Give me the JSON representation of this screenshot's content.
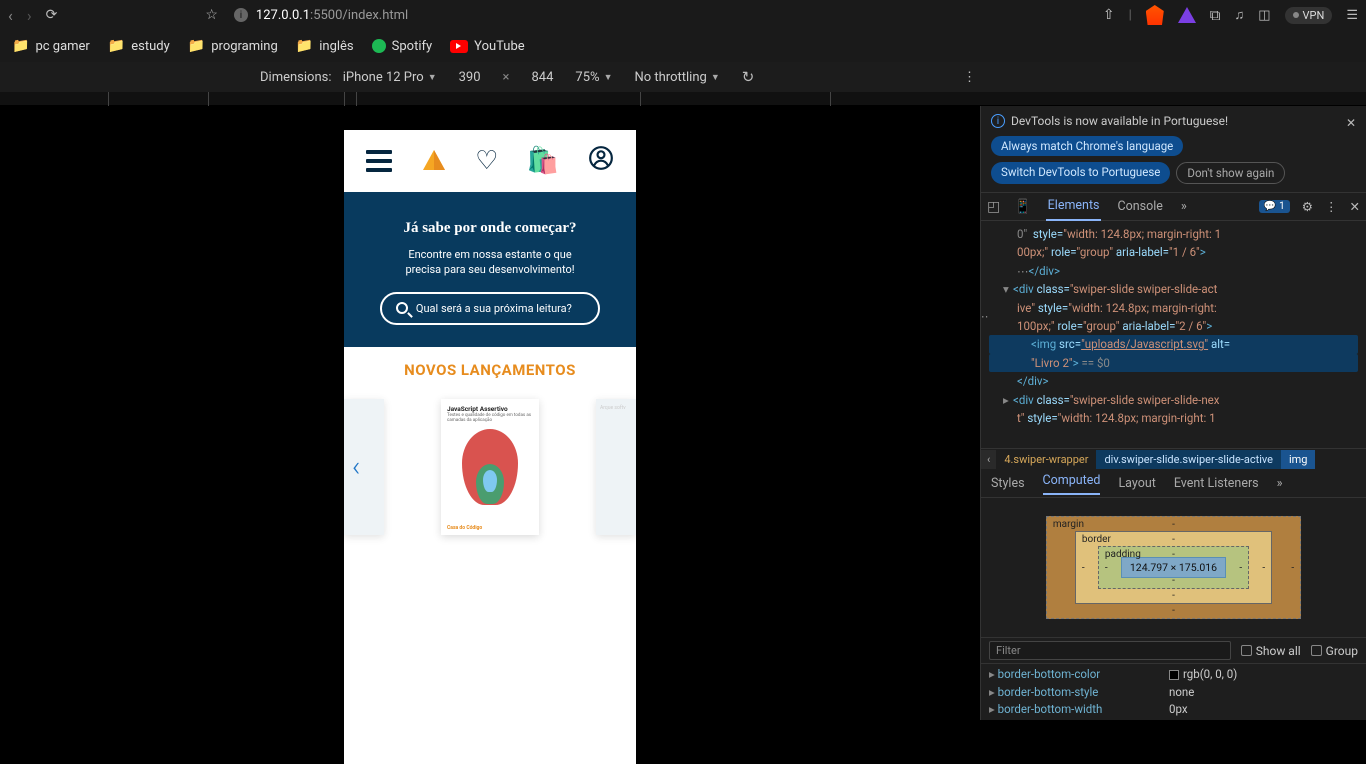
{
  "browser": {
    "url_host": "127.0.0.1",
    "url_path": ":5500/index.html",
    "vpn_label": "VPN"
  },
  "bookmarks": [
    {
      "type": "folder",
      "label": "pc gamer"
    },
    {
      "type": "folder",
      "label": "estudy"
    },
    {
      "type": "folder",
      "label": "programing"
    },
    {
      "type": "folder",
      "label": "inglês"
    },
    {
      "type": "spotify",
      "label": "Spotify"
    },
    {
      "type": "youtube",
      "label": "YouTube"
    }
  ],
  "device_bar": {
    "dimensions_label": "Dimensions:",
    "device": "iPhone 12 Pro",
    "width": "390",
    "sep": "×",
    "height": "844",
    "zoom": "75%",
    "throttle": "No throttling"
  },
  "app": {
    "hero_title": "Já sabe por onde começar?",
    "hero_line1": "Encontre em nossa estante o que",
    "hero_line2": "precisa para seu desenvolvimento!",
    "search_placeholder": "Qual será a sua próxima leitura?",
    "section_title": "NOVOS LANÇAMENTOS",
    "book_title": "JavaScript Assertivo",
    "book_subtitle": "Testes e qualidade de código em todas as camadas da aplicação",
    "book_publisher": "Casa do Código",
    "peek_right": "Arque\nsoftv"
  },
  "devtools": {
    "banner_msg": "DevTools is now available in Portuguese!",
    "pill_match": "Always match Chrome's language",
    "pill_switch": "Switch DevTools to Portuguese",
    "pill_dont": "Don't show again",
    "tabs": {
      "elements": "Elements",
      "console": "Console"
    },
    "msg_count": "1",
    "elements_lines": {
      "l0a": "style=",
      "l0b": "\"width: 124.8px; margin-right: 1",
      "l0c": "00px;\"",
      "l0d": "role=",
      "l0e": "\"group\"",
      "l0f": "aria-label=",
      "l0g": "\"1 / 6\"",
      "l1a": "<div",
      "l1b": "class=",
      "l1c": "\"swiper-slide swiper-slide-act",
      "l1d": "ive\"",
      "l1e": "style=",
      "l1f": "\"width: 124.8px; margin-right:",
      "l1g": "100px;\"",
      "l1h": "role=",
      "l1i": "\"group\"",
      "l1j": "aria-label=",
      "l1k": "\"2 / 6\"",
      "l2a": "<img",
      "l2b": "src=",
      "l2c": "\"uploads/Javascript.svg\"",
      "l2d": "alt=",
      "l2e": "\"Livro 2\"",
      "l2f": "== $0",
      "l3": "</div>",
      "l4a": "<div",
      "l4b": "class=",
      "l4c": "\"swiper-slide swiper-slide-nex",
      "l4d": "t\"",
      "l4e": "style=",
      "l4f": "\"width: 124.8px; margin-right: 1"
    },
    "breadcrumb": {
      "wrap": "4.swiper-wrapper",
      "active": "div.swiper-slide.swiper-slide-active",
      "img": "img"
    },
    "subtabs": {
      "styles": "Styles",
      "computed": "Computed",
      "layout": "Layout",
      "events": "Event Listeners"
    },
    "box_model": {
      "margin": "margin",
      "border": "border",
      "padding": "padding",
      "content": "124.797 × 175.016"
    },
    "filter_placeholder": "Filter",
    "show_all": "Show all",
    "group": "Group",
    "computed": [
      {
        "prop": "border-bottom-color",
        "val": "rgb(0, 0, 0)",
        "swatch": true
      },
      {
        "prop": "border-bottom-style",
        "val": "none"
      },
      {
        "prop": "border-bottom-width",
        "val": "0px"
      }
    ]
  }
}
